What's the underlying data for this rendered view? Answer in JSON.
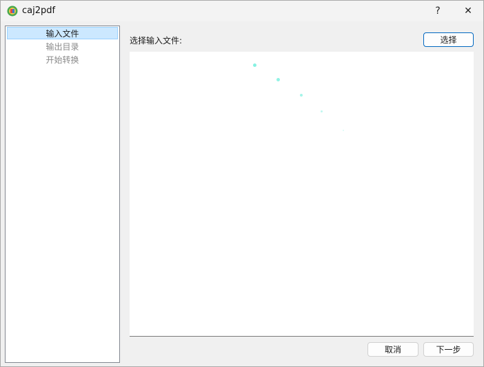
{
  "window": {
    "title": "caj2pdf",
    "help_label": "?",
    "close_label": "✕"
  },
  "nav": {
    "items": [
      {
        "label": "输入文件",
        "active": true
      },
      {
        "label": "输出目录",
        "active": false
      },
      {
        "label": "开始转换",
        "active": false
      }
    ]
  },
  "main": {
    "field_label": "选择输入文件:",
    "select_button": "选择",
    "file_list": []
  },
  "footer": {
    "cancel_button": "取消",
    "next_button": "下一步"
  },
  "colors": {
    "accent": "#0067c0",
    "nav_selected_bg": "#cce8ff",
    "nav_selected_border": "#99d1ff",
    "spinner": "#7ff0e0"
  },
  "icons": {
    "app": "caj2pdf-app-icon",
    "help": "help-icon",
    "close": "close-icon",
    "loading": "loading-spinner-icon"
  }
}
